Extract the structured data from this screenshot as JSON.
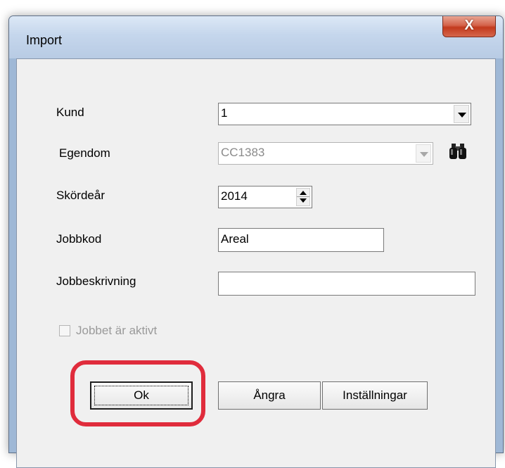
{
  "window": {
    "title": "Import",
    "close_glyph": "X"
  },
  "form": {
    "kund": {
      "label": "Kund",
      "value": "1"
    },
    "egendom": {
      "label": "Egendom",
      "value": "CC1383",
      "search_icon": "binoculars-icon"
    },
    "skordear": {
      "label": "Skördeår",
      "value": "2014"
    },
    "jobbkod": {
      "label": "Jobbkod",
      "value": "Areal"
    },
    "jobbeskrivning": {
      "label": "Jobbeskrivning",
      "value": ""
    },
    "jobbet_aktivt": {
      "label": "Jobbet är aktivt",
      "checked": false
    }
  },
  "buttons": {
    "ok": "Ok",
    "angra": "Ångra",
    "installningar": "Inställningar"
  },
  "colors": {
    "highlight": "#e02c3c",
    "close_button": "#c23a1d"
  }
}
